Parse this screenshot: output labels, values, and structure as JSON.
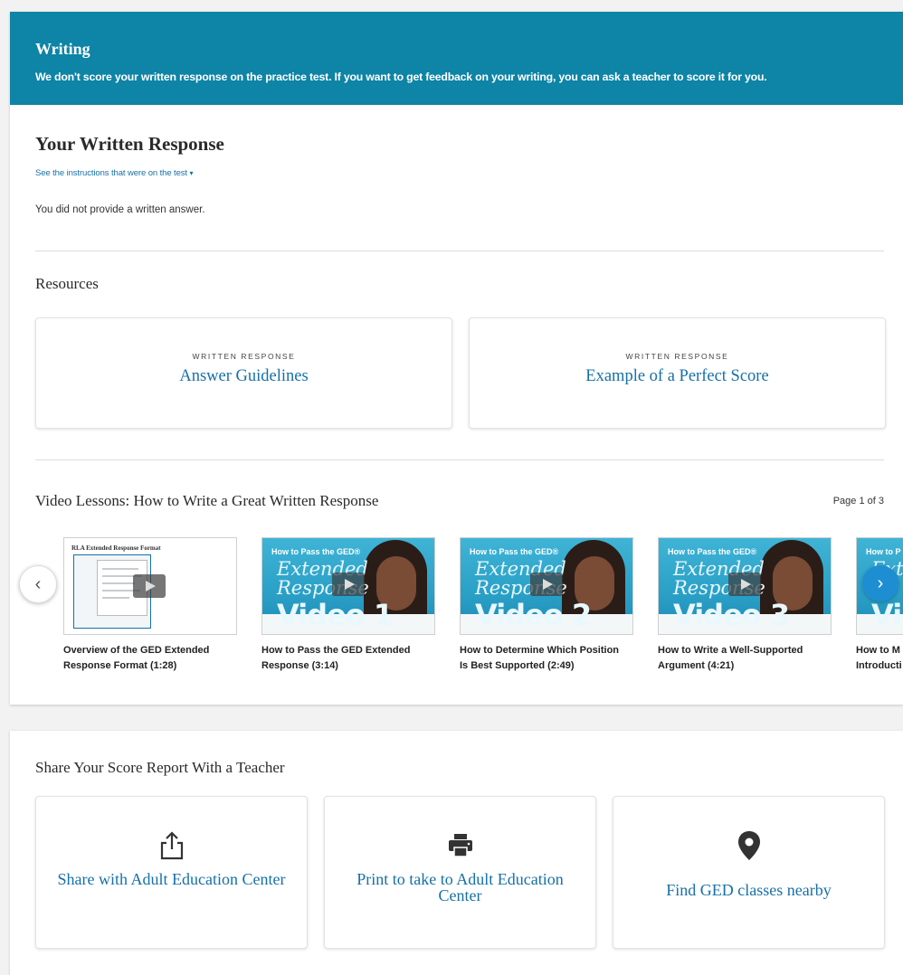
{
  "banner": {
    "title": "Writing",
    "text": "We don't score your written response on the practice test. If you want to get feedback on your writing, you can ask a teacher to score it for you."
  },
  "written_response": {
    "heading": "Your Written Response",
    "instructions_link": "See the instructions that were on the test",
    "status_text": "You did not provide a written answer."
  },
  "resources": {
    "heading": "Resources",
    "cards": [
      {
        "kicker": "WRITTEN RESPONSE",
        "title": "Answer Guidelines"
      },
      {
        "kicker": "WRITTEN RESPONSE",
        "title": "Example of a Perfect Score"
      }
    ]
  },
  "videos": {
    "heading": "Video Lessons: How to Write a Great Written Response",
    "page_indicator": "Page 1 of 3",
    "items": [
      {
        "caption": "Overview of the GED Extended Response Format (1:28)",
        "thumb_title": "RLA Extended Response Format"
      },
      {
        "caption": "How to Pass the GED Extended Response (3:14)",
        "small": "How to Pass the GED®",
        "script": "Extended Response",
        "label": "Video 1"
      },
      {
        "caption": "How to Determine Which Position Is Best Supported (2:49)",
        "small": "How to Pass the GED®",
        "script": "Extended Response",
        "label": "Video 2"
      },
      {
        "caption": "How to Write a Well-Supported Argument (4:21)",
        "small": "How to Pass the GED®",
        "script": "Extended Response",
        "label": "Video 3"
      },
      {
        "caption": "How to M Introducti",
        "small": "How to P",
        "script": "Exte",
        "label": "Vid"
      }
    ]
  },
  "share": {
    "heading": "Share Your Score Report With a Teacher",
    "cards": [
      {
        "label": "Share with Adult Education Center",
        "icon": "share-icon"
      },
      {
        "label": "Print to take to Adult Education Center",
        "icon": "print-icon"
      },
      {
        "label": "Find GED classes nearby",
        "icon": "location-pin-icon"
      }
    ]
  },
  "colors": {
    "banner": "#0e84a6",
    "link": "#1670a8",
    "next_arrow": "#1e8ed2"
  }
}
